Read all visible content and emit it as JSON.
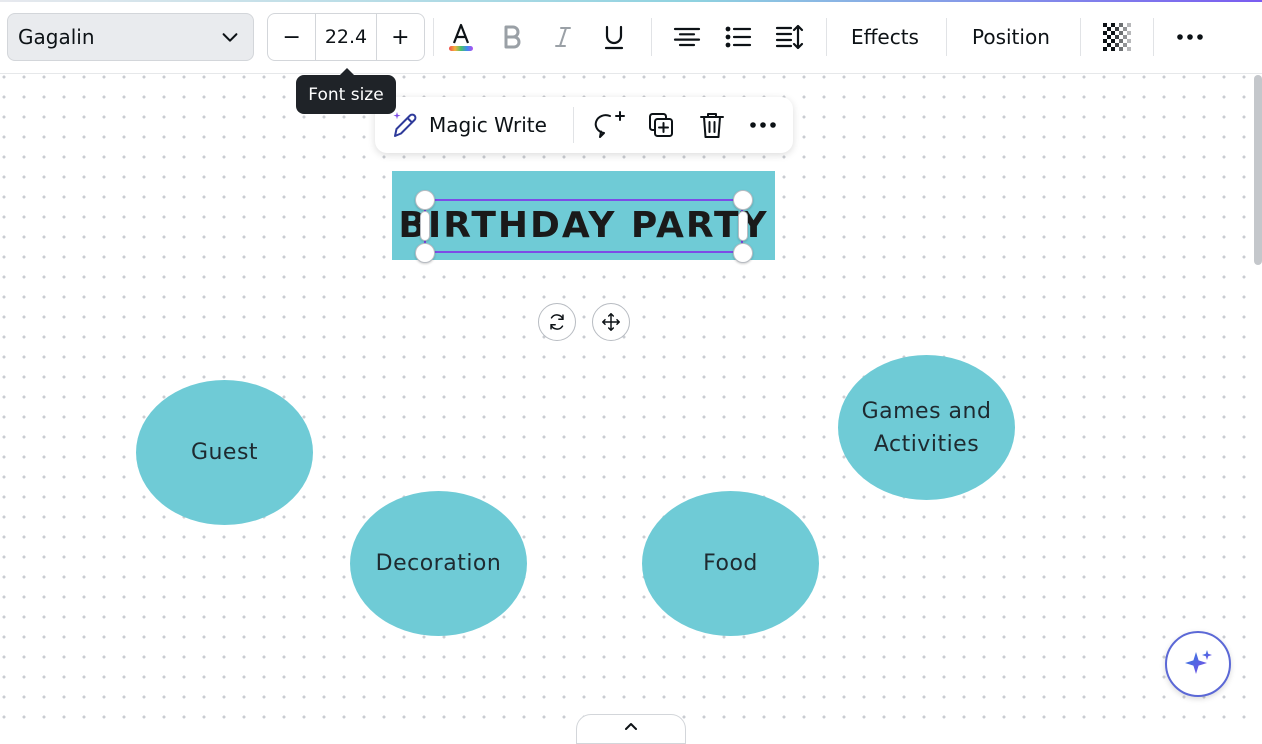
{
  "toolbar": {
    "font_family": "Gagalin",
    "font_size": "22.4",
    "decrease_label": "−",
    "increase_label": "+",
    "effects_label": "Effects",
    "position_label": "Position",
    "icons": [
      "text-color-icon",
      "bold-icon",
      "italic-icon",
      "underline-icon",
      "align-center-icon",
      "bullet-list-icon",
      "line-spacing-icon",
      "transparency-icon",
      "more-icon"
    ]
  },
  "tooltip": {
    "text": "Font size"
  },
  "context_menu": {
    "magic_write_label": "Magic Write",
    "icons": [
      "magic-write-icon",
      "add-comment-icon",
      "duplicate-icon",
      "delete-icon",
      "more-icon"
    ]
  },
  "canvas": {
    "title": "BIRTHDAY PARTY",
    "bubbles": {
      "guest": "Guest",
      "decoration": "Decoration",
      "food": "Food",
      "games_line1": "Games and",
      "games_line2": "Activities"
    }
  },
  "colors": {
    "bubble": "#6fcbd6",
    "selection": "#7d4ce6",
    "tooltip_bg": "#1f2328"
  }
}
